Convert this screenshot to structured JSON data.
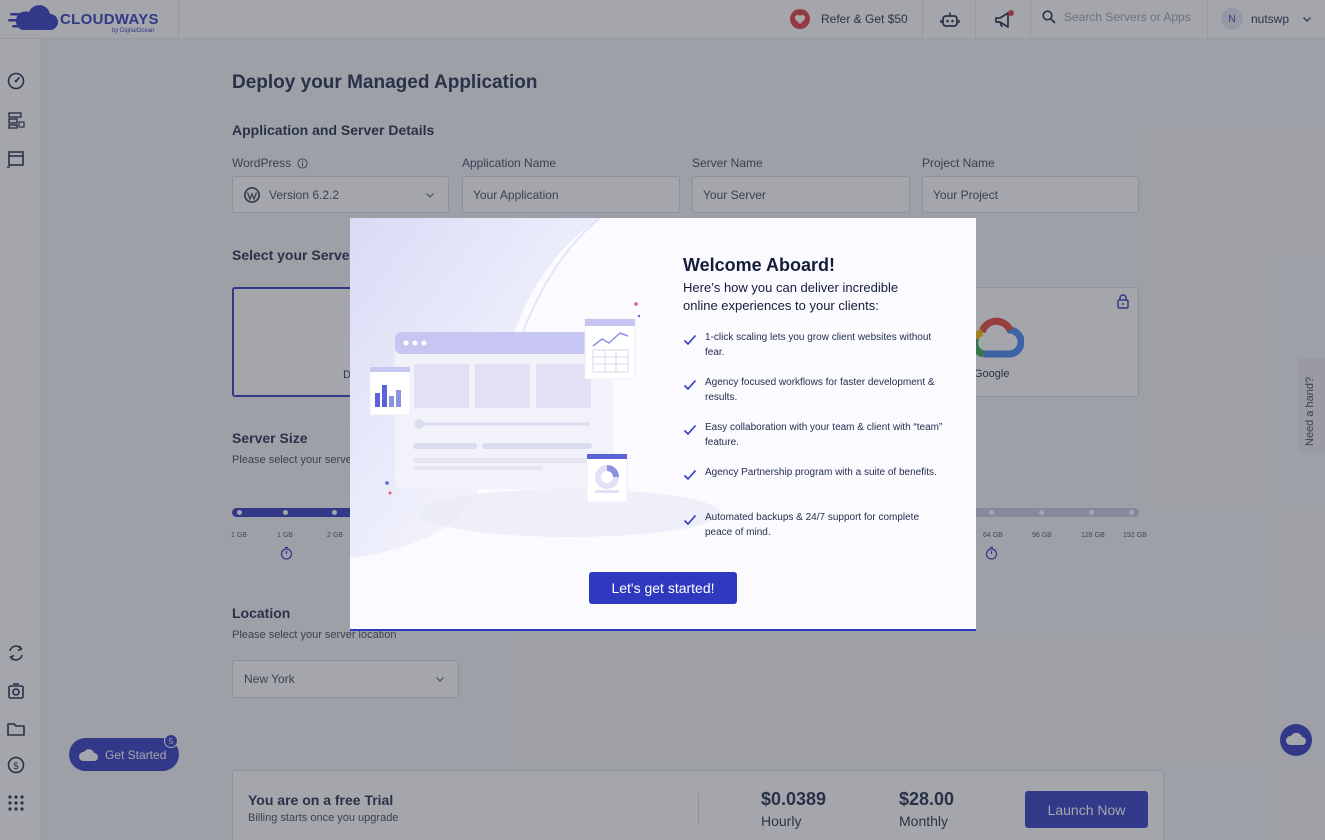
{
  "header": {
    "logo_text": "CLOUDWAYS",
    "logo_sub": "by DigitalOcean",
    "refer_label": "Refer & Get $50",
    "search_placeholder": "Search Servers or Apps",
    "user_initial": "N",
    "user_name": "nutswp"
  },
  "page": {
    "title": "Deploy your Managed Application",
    "details_heading": "Application and Server Details",
    "fields": {
      "app_type_label": "WordPress",
      "app_version": "Version 6.2.2",
      "app_name_label": "Application Name",
      "app_name_value": "Your Application",
      "server_name_label": "Server Name",
      "server_name_value": "Your Server",
      "project_name_label": "Project Name",
      "project_name_value": "Your Project"
    },
    "server_heading": "Select your Server",
    "provider_first_label": "D",
    "provider_last_label": "Google",
    "size_heading": "Server Size",
    "size_sub": "Please select your server size",
    "sizes_left": [
      "1 GB",
      "1 GB",
      "2 GB"
    ],
    "sizes_right": [
      "64 GB",
      "96 GB",
      "128 GB",
      "192 GB"
    ],
    "location_heading": "Location",
    "location_sub": "Please select your server location",
    "location_value": "New York"
  },
  "trial": {
    "title": "You are on a free Trial",
    "sub": "Billing starts once you upgrade",
    "hourly_price": "$0.0389",
    "hourly_label": "Hourly",
    "monthly_price": "$28.00",
    "monthly_label": "Monthly",
    "launch_label": "Launch Now"
  },
  "widgets": {
    "get_started_label": "Get Started",
    "get_started_count": "5",
    "need_hand_label": "Need a hand?"
  },
  "modal": {
    "title": "Welcome Aboard!",
    "intro": "Here’s how you can deliver incredible online experiences to your clients:",
    "features": [
      "1-click scaling lets you grow client websites without fear.",
      "Agency focused workflows for faster development & results.",
      "Easy collaboration with your team & client with “team” feature.",
      "Agency Partnership program with a suite of benefits.",
      "Automated backups & 24/7 support for complete peace of mind."
    ],
    "cta_label": "Let's get started!"
  },
  "colors": {
    "brand": "#2f39bf",
    "refer_heart": "#e03b45",
    "notification_dot": "#e03b45",
    "overlay": "rgba(55,58,68,0.45)"
  },
  "icons": {
    "sidebar_top": [
      "dashboard-gauge-icon",
      "servers-grid-icon",
      "applications-window-icon"
    ],
    "sidebar_bottom": [
      "migration-arrows-icon",
      "add-ons-gear-icon",
      "projects-folder-icon",
      "billing-dollar-icon",
      "apps-grid-icon"
    ],
    "topbar": [
      "heart-icon",
      "bot-icon",
      "megaphone-icon",
      "search-icon",
      "chevron-down-icon"
    ]
  }
}
